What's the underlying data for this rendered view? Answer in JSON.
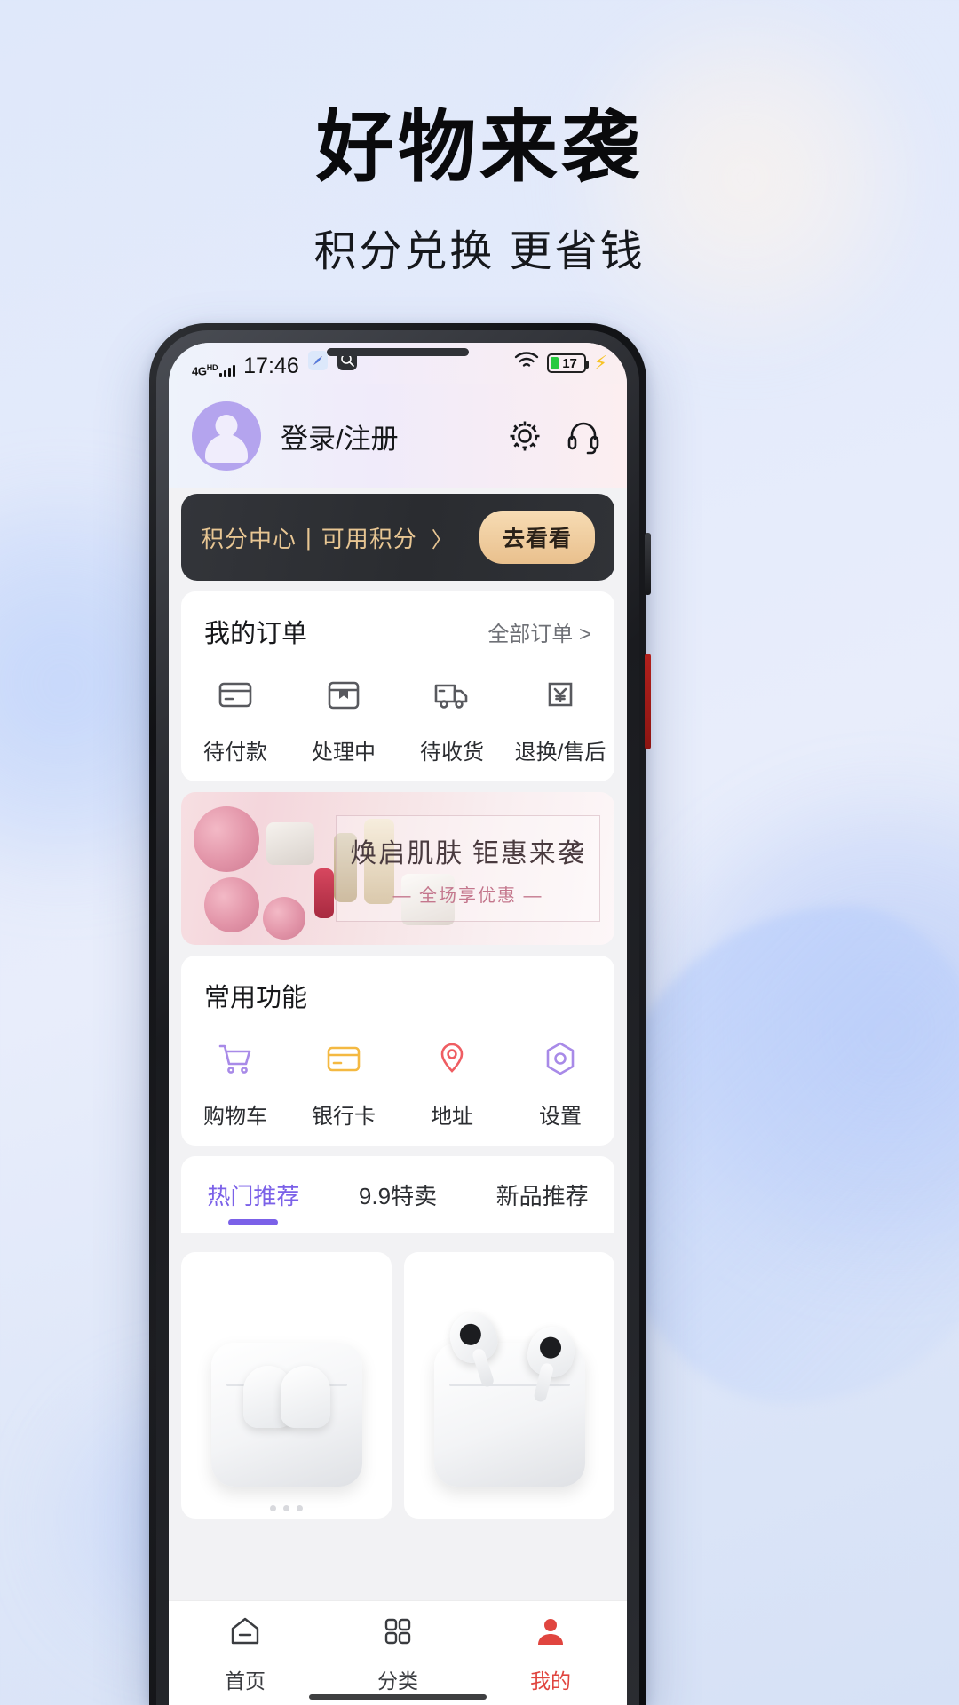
{
  "hero": {
    "title": "好物来袭",
    "subtitle": "积分兑换 更省钱"
  },
  "statusbar": {
    "network": "4G",
    "network_sup": "HD",
    "time": "17:46",
    "icons": [
      "compass-icon",
      "search-app-icon",
      "wifi-icon"
    ],
    "battery_percent": "17",
    "charging": "⚡"
  },
  "header": {
    "login_label": "登录/注册",
    "icons": [
      "gear-icon",
      "headset-icon"
    ]
  },
  "points": {
    "label_a": "积分中心",
    "divider": "|",
    "label_b": "可用积分",
    "arrow": "〉",
    "button": "去看看"
  },
  "orders": {
    "title": "我的订单",
    "more": "全部订单 >",
    "items": [
      {
        "label": "待付款",
        "icon": "wallet-card-icon"
      },
      {
        "label": "处理中",
        "icon": "box-package-icon"
      },
      {
        "label": "待收货",
        "icon": "truck-delivery-icon"
      },
      {
        "label": "退换/售后",
        "icon": "refund-yen-icon"
      }
    ]
  },
  "promo": {
    "main": "焕启肌肤 钜惠来袭",
    "sub": "— 全场享优惠 —"
  },
  "functions": {
    "title": "常用功能",
    "items": [
      {
        "label": "购物车",
        "icon": "shopping-cart-icon",
        "color": "#a88ae8"
      },
      {
        "label": "银行卡",
        "icon": "bank-card-icon",
        "color": "#f4b942"
      },
      {
        "label": "地址",
        "icon": "location-pin-icon",
        "color": "#ef5d62"
      },
      {
        "label": "设置",
        "icon": "settings-hex-icon",
        "color": "#a88ae8"
      }
    ]
  },
  "tabs": [
    {
      "label": "热门推荐",
      "active": true
    },
    {
      "label": "9.9特卖",
      "active": false
    },
    {
      "label": "新品推荐",
      "active": false
    }
  ],
  "products": [
    {
      "name": "airpods-gen2-case"
    },
    {
      "name": "airpods-gen3-case"
    }
  ],
  "bottomnav": [
    {
      "label": "首页",
      "icon": "home-icon",
      "active": false
    },
    {
      "label": "分类",
      "icon": "category-grid-icon",
      "active": false
    },
    {
      "label": "我的",
      "icon": "person-icon",
      "active": true
    }
  ],
  "colors": {
    "accent_purple": "#7b61e8",
    "accent_gold": "#e8c693",
    "accent_red": "#e0453f",
    "dark_bar": "#2e3034"
  }
}
